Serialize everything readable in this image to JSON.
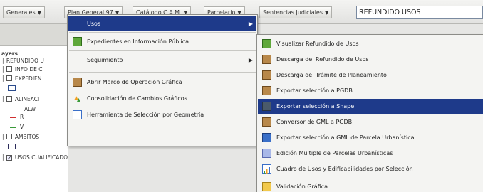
{
  "toolbar": {
    "buttons": [
      {
        "label": "Generales"
      },
      {
        "label": "Plan General 97"
      },
      {
        "label": "Catálogo C.A.M."
      },
      {
        "label": "Parcelario"
      },
      {
        "label": "Sentencias Judiciales"
      }
    ],
    "caret": "▼",
    "search_value": "REFUNDIDO USOS"
  },
  "layer_panel": {
    "title": "ayers",
    "items": [
      {
        "label": "REFUNDIDO U"
      },
      {
        "label": "INFO DE C"
      },
      {
        "label": "EXPEDIEN"
      },
      {
        "label": "ALINEACI"
      },
      {
        "label": "ALW_"
      },
      {
        "label": "R"
      },
      {
        "label": "V"
      },
      {
        "label": "ÁMBITOS"
      },
      {
        "label": "USOS CUALIFICADOS"
      }
    ]
  },
  "main_menu": {
    "items": [
      {
        "label": "Usos",
        "icon": "none",
        "submenu": true,
        "highlighted": true
      },
      {
        "label": "Expedientes en Información Pública",
        "icon": "green-grid-icon",
        "submenu": false
      },
      {
        "label": "Seguimiento",
        "icon": "none",
        "submenu": true
      },
      {
        "label": "Abrir Marco de Operación Gráfica",
        "icon": "brown-map-icon",
        "submenu": false
      },
      {
        "label": "Consolidación de Cambios Gráficos",
        "icon": "recycle-icon",
        "submenu": false
      },
      {
        "label": "Herramienta de Selección por Geometría",
        "icon": "selection-icon",
        "submenu": false
      }
    ],
    "arrow": "▶"
  },
  "usos_submenu": {
    "items": [
      {
        "label": "Visualizar Refundido de Usos",
        "icon": "green-grid-icon"
      },
      {
        "label": "Descarga del Refundido de Usos",
        "icon": "brown-map-icon"
      },
      {
        "label": "Descarga del Trámite de Planeamiento",
        "icon": "brown-map-icon"
      },
      {
        "label": "Exportar selección a PGDB",
        "icon": "brown-map-icon"
      },
      {
        "label": "Exportar selección a Shape",
        "icon": "dark-map-icon",
        "highlighted": true
      },
      {
        "label": "Conversor de GML a PGDB",
        "icon": "brown-map-icon"
      },
      {
        "label": "Exportar selección a GML de Parcela Urbanística",
        "icon": "blue-grid-icon"
      },
      {
        "label": "Edición Múltiple de Parcelas Urbanísticas",
        "icon": "lavender-grid-icon"
      },
      {
        "label": "Cuadro de Usos y Edificabilidades por Selección",
        "icon": "chart-icon"
      },
      {
        "label": "Validación Gráfica",
        "icon": "yellow-icon"
      }
    ]
  },
  "colors": {
    "menu_highlight": "#1e3a8a",
    "legend_red": "#d03030",
    "legend_green": "#3a9a3a",
    "legend_blue": "#2b4b8c"
  }
}
